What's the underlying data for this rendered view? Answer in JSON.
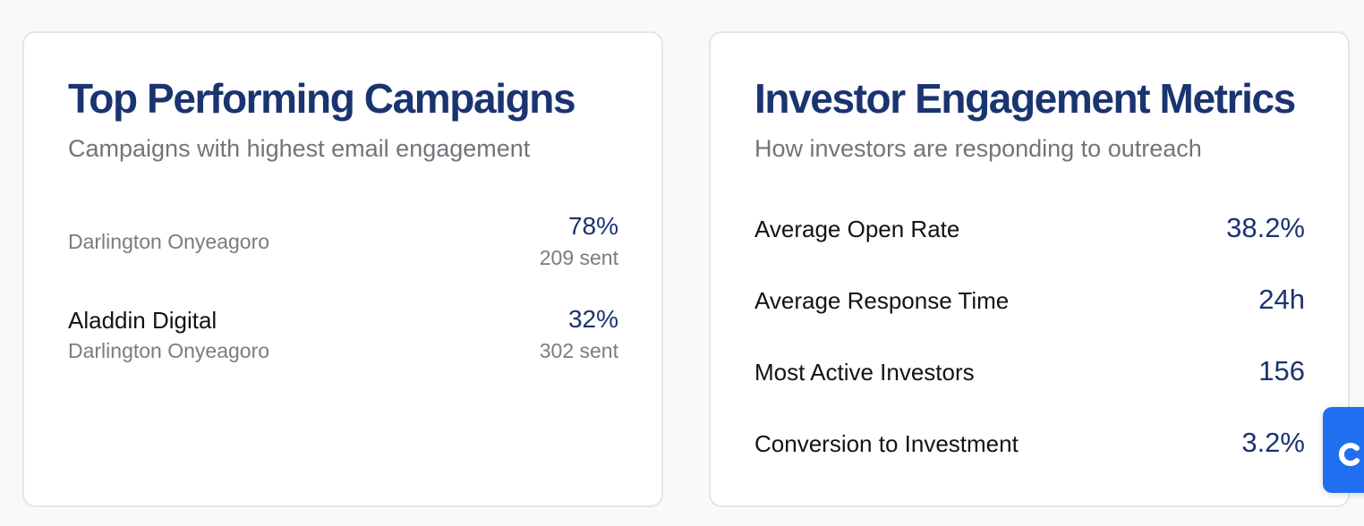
{
  "campaigns_card": {
    "title": "Top Performing Campaigns",
    "subtitle": "Campaigns with highest email engagement",
    "items": [
      {
        "name": "",
        "owner": "Darlington Onyeagoro",
        "rate": "78%",
        "sent": "209 sent"
      },
      {
        "name": "Aladdin Digital",
        "owner": "Darlington Onyeagoro",
        "rate": "32%",
        "sent": "302 sent"
      }
    ]
  },
  "metrics_card": {
    "title": "Investor Engagement Metrics",
    "subtitle": "How investors are responding to outreach",
    "items": [
      {
        "label": "Average Open Rate",
        "value": "38.2%"
      },
      {
        "label": "Average Response Time",
        "value": "24h"
      },
      {
        "label": "Most Active Investors",
        "value": "156"
      },
      {
        "label": "Conversion to Investment",
        "value": "3.2%"
      }
    ]
  },
  "chat_widget": {
    "icon": "chat-logo-icon",
    "color": "#1f6ff0"
  },
  "colors": {
    "heading": "#1a3470",
    "accent_value": "#1a3470",
    "muted_text": "#7a7c84",
    "card_border": "#e3e5ea"
  }
}
